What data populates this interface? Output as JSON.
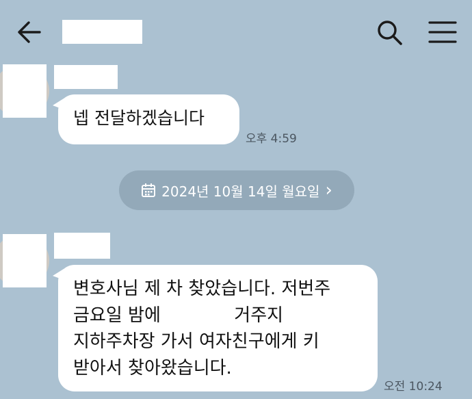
{
  "header": {
    "chat_title": "",
    "back_icon": "arrow-left-icon",
    "search_icon": "search-icon",
    "menu_icon": "hamburger-menu-icon"
  },
  "colors": {
    "background": "#abc1d1",
    "bubble": "#ffffff",
    "date_pill": "#93a9b9",
    "timestamp_text": "#4b5660"
  },
  "messages": [
    {
      "sender_name": "",
      "lines": [
        "넵 전달하겠습니다"
      ],
      "time": "오후 4:59"
    },
    {
      "sender_name": "",
      "lines": [
        "변호사님 제 차 찾았습니다. 저번주",
        "금요일 밤에             거주지",
        "지하주차장 가서 여자친구에게 키",
        "받아서 찾아왔습니다."
      ],
      "time": "오전 10:24"
    }
  ],
  "date_divider": {
    "label": "2024년 10월 14일 월요일",
    "icon": "calendar-icon",
    "chevron": "›"
  }
}
